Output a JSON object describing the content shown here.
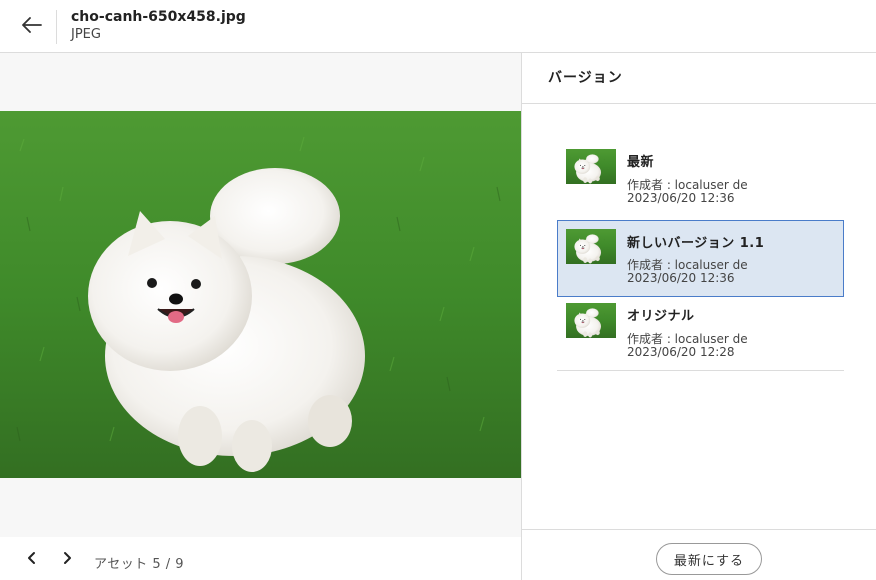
{
  "header": {
    "file_name": "cho-canh-650x458.jpg",
    "file_type": "JPEG",
    "back_icon": "arrow-left-icon"
  },
  "viewer": {
    "image_subject": "white pomeranian on grass",
    "prev_icon": "chevron-left-icon",
    "next_icon": "chevron-right-icon",
    "asset_counter": "アセット 5 / 9"
  },
  "side_panel": {
    "title": "バージョン",
    "versions": [
      {
        "label": "最新",
        "author": "作成者 : localuser de",
        "date": "2023/06/20 12:36",
        "selected": false
      },
      {
        "label": "新しいバージョン 1.1",
        "author": "作成者 : localuser de",
        "date": "2023/06/20 12:36",
        "selected": true
      },
      {
        "label": "オリジナル",
        "author": "作成者 : localuser de",
        "date": "2023/06/20 12:28",
        "selected": false
      }
    ],
    "make_latest_label": "最新にする"
  },
  "colors": {
    "selected_bg": "#dce6f2",
    "selected_border": "#4a7cc9",
    "grass": "#3f8a2a"
  }
}
